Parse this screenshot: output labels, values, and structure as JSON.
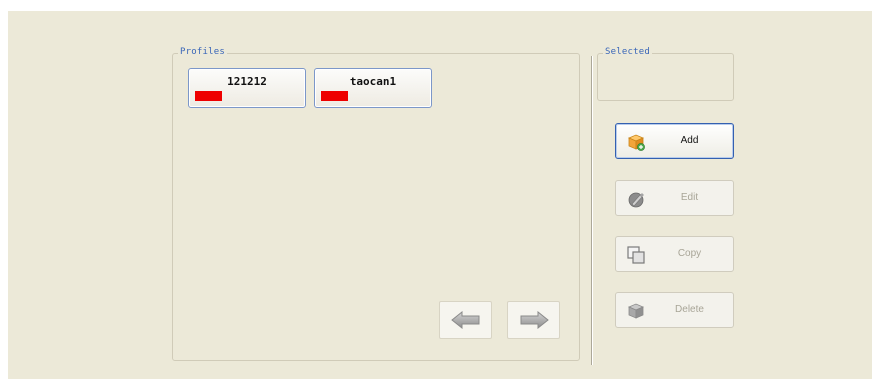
{
  "profiles_group": {
    "title": "Profiles",
    "profiles": [
      {
        "name": "121212",
        "color": "#EE0000"
      },
      {
        "name": "taocan1",
        "color": "#EE0000"
      }
    ]
  },
  "selected_group": {
    "title": "Selected"
  },
  "navigation": {
    "prev_icon": "arrow-left-icon",
    "next_icon": "arrow-right-icon"
  },
  "actions": {
    "add_label": "Add",
    "edit_label": "Edit",
    "copy_label": "Copy",
    "delete_label": "Delete",
    "add_icon": "box-add-icon",
    "edit_icon": "edit-icon",
    "copy_icon": "copy-icon",
    "delete_icon": "delete-icon"
  },
  "colors": {
    "background": "#ECE9D8",
    "group_title": "#3A66B8",
    "active_border": "#3460B0",
    "disabled_text": "#A8A597",
    "profile_swatch": "#EE0000"
  }
}
